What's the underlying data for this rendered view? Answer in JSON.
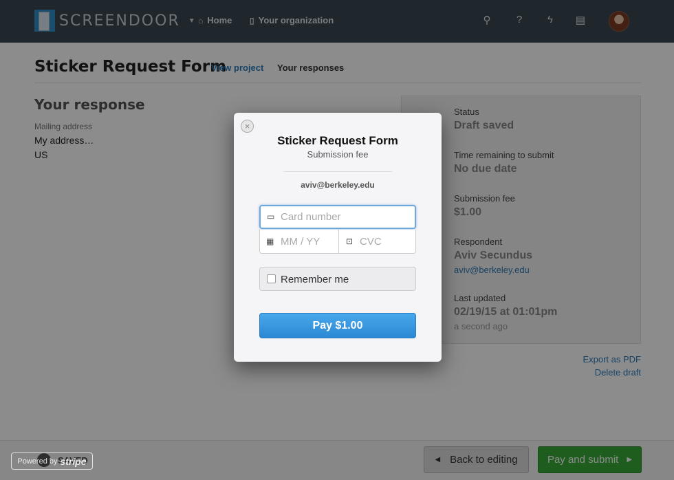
{
  "nav": {
    "brand": "SCREENDOOR",
    "home": "Home",
    "organization": "Your organization"
  },
  "page": {
    "title": "Sticker Request Form",
    "tab_view_project": "View project",
    "tab_your_responses": "Your responses"
  },
  "response": {
    "heading": "Your response",
    "field_label": "Mailing address",
    "field_lines": [
      "My address…",
      "US"
    ]
  },
  "side": {
    "status_label": "Status",
    "status_value": "Draft saved",
    "time_label": "Time remaining to submit",
    "time_value": "No due date",
    "fee_label": "Submission fee",
    "fee_value": "$1.00",
    "respondent_label": "Respondent",
    "respondent_name": "Aviv Secundus",
    "respondent_email": "aviv@berkeley.edu",
    "updated_label": "Last updated",
    "updated_value": "02/19/15 at 01:01pm",
    "updated_ago": "a second ago"
  },
  "actions": {
    "export_pdf": "Export as PDF",
    "delete_draft": "Delete draft",
    "back": "Back to editing",
    "submit": "Pay and submit",
    "saved": "SAVED"
  },
  "powered": {
    "prefix": "Powered by",
    "brand": "stripe"
  },
  "modal": {
    "close_glyph": "×",
    "title": "Sticker Request Form",
    "subtitle": "Submission fee",
    "email": "aviv@berkeley.edu",
    "card_placeholder": "Card number",
    "expiry_placeholder": "MM / YY",
    "cvc_placeholder": "CVC",
    "remember": "Remember me",
    "pay": "Pay $1.00"
  }
}
